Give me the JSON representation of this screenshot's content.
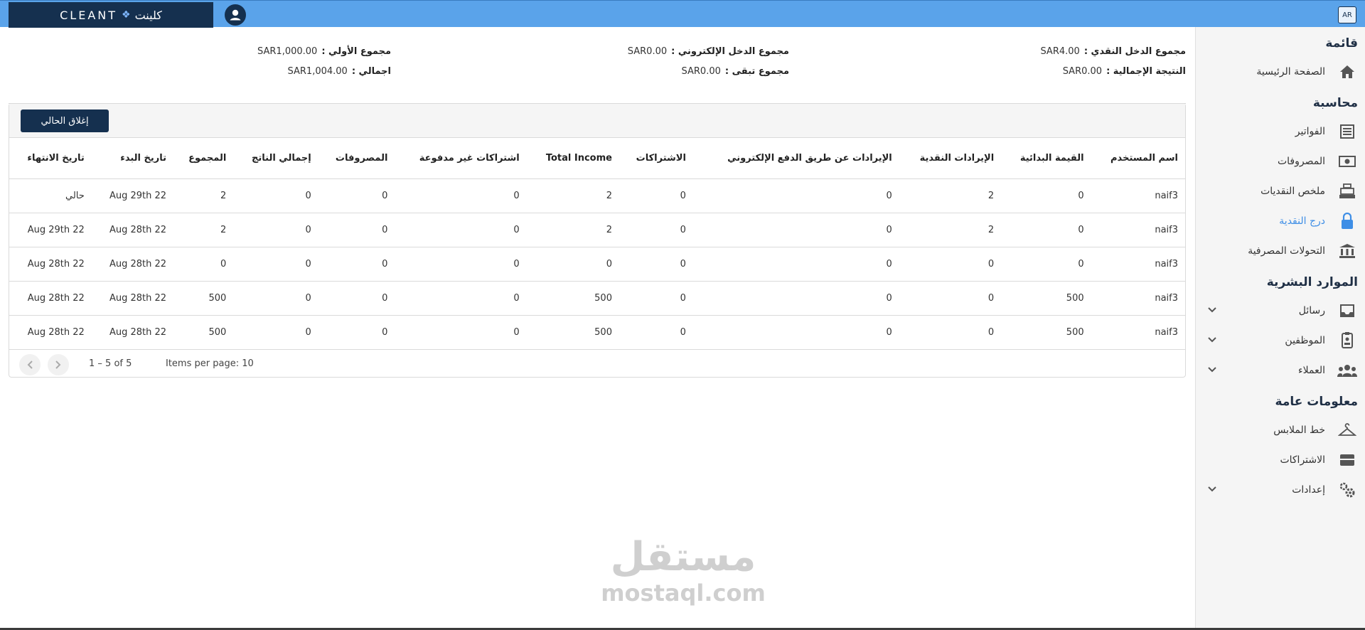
{
  "topbar": {
    "logo_latin": "CLEANT",
    "logo_arabic": "كلينت",
    "lang_label": "AR"
  },
  "sidebar": {
    "sections": [
      {
        "title": "قائمة",
        "items": [
          {
            "label": "الصفحة الرئيسية",
            "icon": "home-icon"
          }
        ]
      },
      {
        "title": "محاسبة",
        "items": [
          {
            "label": "الفواتير",
            "icon": "invoice-icon"
          },
          {
            "label": "المصروفات",
            "icon": "cash-icon"
          },
          {
            "label": "ملخص النقديات",
            "icon": "register-icon"
          },
          {
            "label": "درج النقدية",
            "icon": "lock-icon",
            "active": true
          },
          {
            "label": "التحولات المصرفية",
            "icon": "bank-icon"
          }
        ]
      },
      {
        "title": "الموارد البشرية",
        "items": [
          {
            "label": "رسائل",
            "icon": "inbox-icon",
            "expandable": true
          },
          {
            "label": "الموظفين",
            "icon": "badge-icon",
            "expandable": true
          },
          {
            "label": "العملاء",
            "icon": "group-icon",
            "expandable": true
          }
        ]
      },
      {
        "title": "معلومات عامة",
        "items": [
          {
            "label": "خط الملابس",
            "icon": "hanger-icon"
          },
          {
            "label": "الاشتراكات",
            "icon": "subscription-icon"
          },
          {
            "label": "إعدادات",
            "icon": "gears-icon",
            "expandable": true
          }
        ]
      }
    ]
  },
  "summary": {
    "cash_income_label": "مجموع الدخل النقدي :",
    "cash_income_value": "SAR4.00",
    "total_result_label": "النتيجة الإجمالية :",
    "total_result_value": "SAR0.00",
    "electronic_income_label": "مجموع الدخل الإلكتروني :",
    "electronic_income_value": "SAR0.00",
    "remaining_label": "مجموع تبقى :",
    "remaining_value": "SAR0.00",
    "initial_label": "مجموع الأولي :",
    "initial_value": "SAR1,000.00",
    "grand_total_label": "اجمالي :",
    "grand_total_value": "SAR1,004.00"
  },
  "actions": {
    "close_current_label": "إغلاق الحالي"
  },
  "table": {
    "headers": [
      "اسم المستخدم",
      "القيمة البدائية",
      "الإيرادات النقدية",
      "الإيرادات عن طريق الدفع الإلكتروني",
      "الاشتراكات",
      "Total Income",
      "اشتراكات غير مدفوعة",
      "المصروفات",
      "إجمالي الناتج",
      "المجموع",
      "تاريخ البدء",
      "تاريخ الانتهاء"
    ],
    "rows": [
      [
        "naif3",
        "0",
        "2",
        "0",
        "0",
        "2",
        "0",
        "0",
        "0",
        "2",
        "Aug 29th 22",
        "حالي"
      ],
      [
        "naif3",
        "0",
        "2",
        "0",
        "0",
        "2",
        "0",
        "0",
        "0",
        "2",
        "Aug 28th 22",
        "Aug 29th 22"
      ],
      [
        "naif3",
        "0",
        "0",
        "0",
        "0",
        "0",
        "0",
        "0",
        "0",
        "0",
        "Aug 28th 22",
        "Aug 28th 22"
      ],
      [
        "naif3",
        "500",
        "0",
        "0",
        "0",
        "500",
        "0",
        "0",
        "0",
        "500",
        "Aug 28th 22",
        "Aug 28th 22"
      ],
      [
        "naif3",
        "500",
        "0",
        "0",
        "0",
        "500",
        "0",
        "0",
        "0",
        "500",
        "Aug 28th 22",
        "Aug 28th 22"
      ]
    ]
  },
  "pagination": {
    "items_per_page": "Items per page: 10",
    "range": "1 – 5 of 5"
  },
  "watermark": {
    "arabic": "مستقل",
    "latin": "mostaql.com"
  }
}
